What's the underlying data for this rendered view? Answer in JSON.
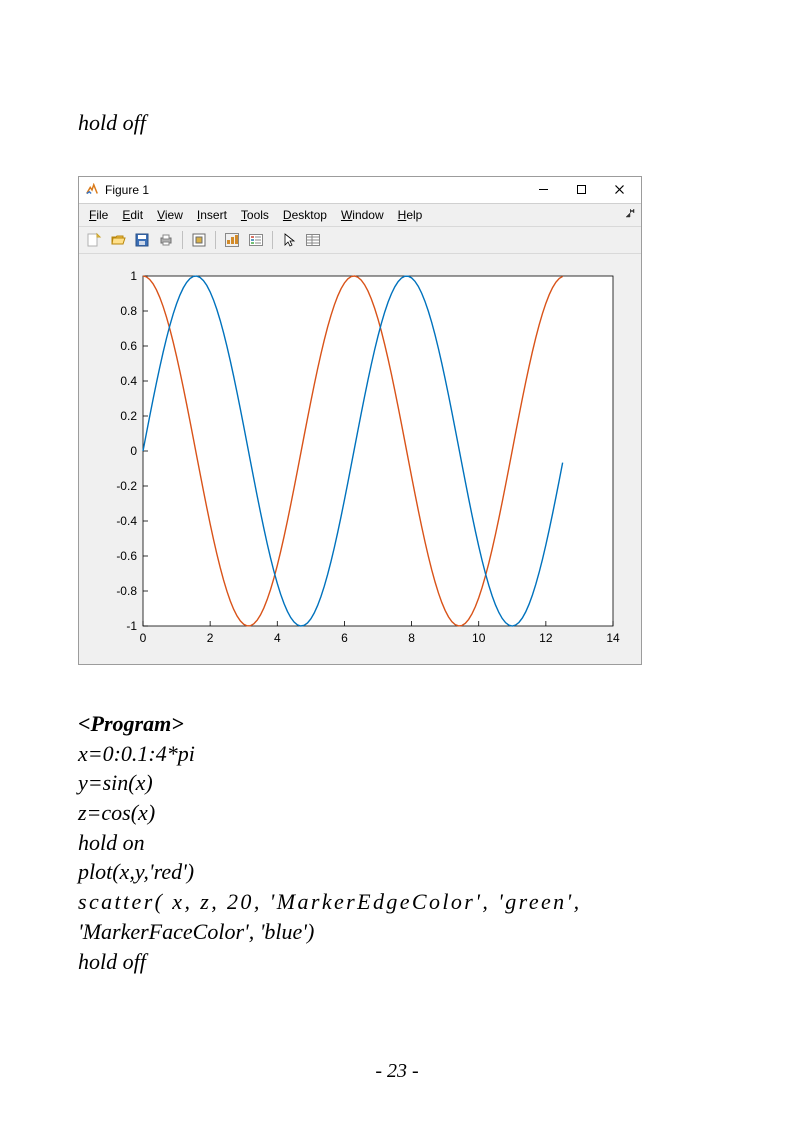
{
  "header_text": "hold off",
  "figure_window": {
    "title": "Figure 1",
    "menus": [
      "File",
      "Edit",
      "View",
      "Insert",
      "Tools",
      "Desktop",
      "Window",
      "Help"
    ],
    "toolbar_icons": [
      "new",
      "open",
      "save",
      "print",
      "|",
      "link",
      "|",
      "datacursor",
      "legend",
      "|",
      "arrow",
      "inspect"
    ]
  },
  "chart_data": {
    "type": "line",
    "xlim": [
      0,
      14
    ],
    "ylim": [
      -1,
      1
    ],
    "xticks": [
      0,
      2,
      4,
      6,
      8,
      10,
      12,
      14
    ],
    "yticks": [
      -1,
      -0.8,
      -0.6,
      -0.4,
      -0.2,
      0,
      0.2,
      0.4,
      0.6,
      0.8,
      1
    ],
    "x_step": 0.1,
    "x_max": 12.566,
    "series": [
      {
        "name": "cos(x)",
        "color": "#d95319",
        "fn": "cos"
      },
      {
        "name": "sin(x)",
        "color": "#0072bd",
        "fn": "sin"
      }
    ],
    "x": "0:0.1:4*pi"
  },
  "code": {
    "heading": "<Program>",
    "lines": [
      "x=0:0.1:4*pi",
      "y=sin(x)",
      "z=cos(x)",
      "hold on",
      "plot(x,y,'red')"
    ],
    "scatter_line_a": "scatter( x, z, 20, 'MarkerEdgeColor', 'green',",
    "scatter_line_b": "'MarkerFaceColor', 'blue')",
    "last": "hold off"
  },
  "page_number": "- 23 -"
}
